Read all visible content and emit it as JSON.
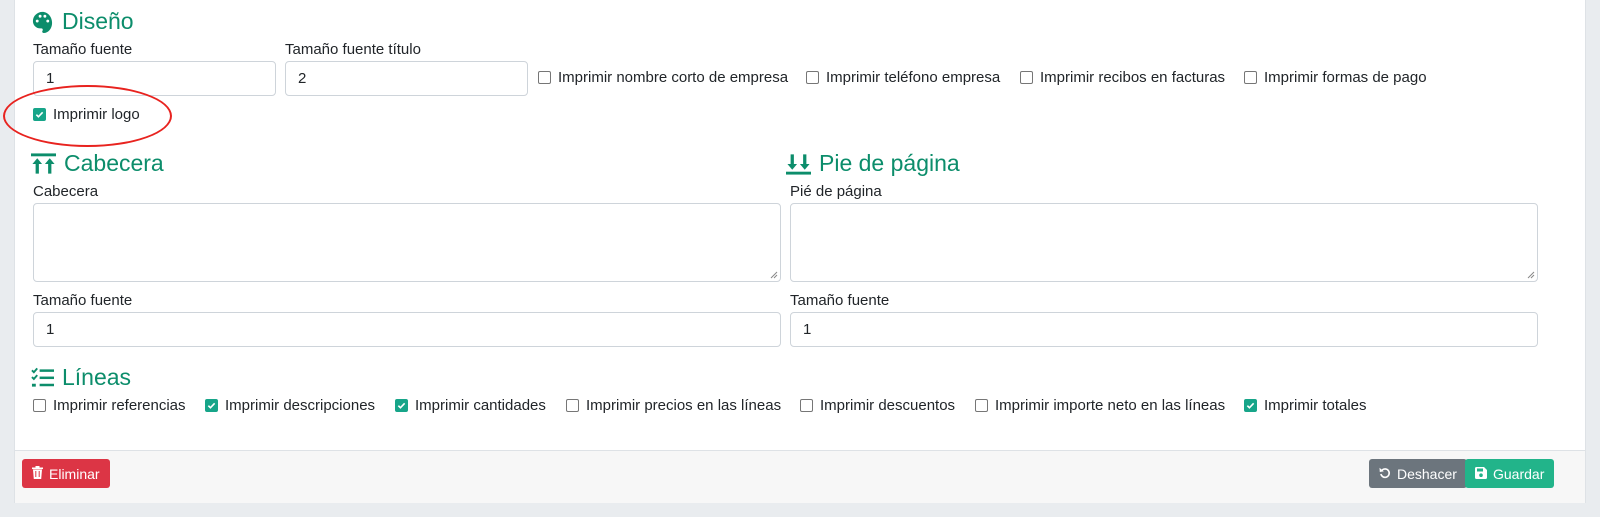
{
  "diseno": {
    "title": "Diseño",
    "icon": "palette-icon",
    "font_size_label": "Tamaño fuente",
    "font_size_value": "1",
    "title_font_size_label": "Tamaño fuente título",
    "title_font_size_value": "2",
    "checks": [
      {
        "label": "Imprimir nombre corto de empresa",
        "checked": false
      },
      {
        "label": "Imprimir teléfono empresa",
        "checked": false
      },
      {
        "label": "Imprimir recibos en facturas",
        "checked": false
      },
      {
        "label": "Imprimir formas de pago",
        "checked": false
      },
      {
        "label": "Imprimir logo",
        "checked": true
      }
    ]
  },
  "cabecera": {
    "title": "Cabecera",
    "icon": "arrow-up-to-line-icon",
    "textarea_label": "Cabecera",
    "font_size_label": "Tamaño fuente",
    "font_size_value": "1"
  },
  "pie": {
    "title": "Pie de página",
    "icon": "arrow-down-to-line-icon",
    "textarea_label": "Pié de página",
    "font_size_label": "Tamaño fuente",
    "font_size_value": "1"
  },
  "lineas": {
    "title": "Líneas",
    "icon": "list-check-icon",
    "checks": [
      {
        "label": "Imprimir referencias",
        "checked": false
      },
      {
        "label": "Imprimir descripciones",
        "checked": true
      },
      {
        "label": "Imprimir cantidades",
        "checked": true
      },
      {
        "label": "Imprimir precios en las líneas",
        "checked": false
      },
      {
        "label": "Imprimir descuentos",
        "checked": false
      },
      {
        "label": "Imprimir importe neto en las líneas",
        "checked": false
      },
      {
        "label": "Imprimir totales",
        "checked": true
      }
    ]
  },
  "footer": {
    "delete_label": "Eliminar",
    "undo_label": "Deshacer",
    "save_label": "Guardar"
  },
  "colors": {
    "accent": "#0c8d6b",
    "danger": "#dc3545",
    "secondary": "#6c757d",
    "success": "#22b48a",
    "annotation": "#e8231f"
  }
}
